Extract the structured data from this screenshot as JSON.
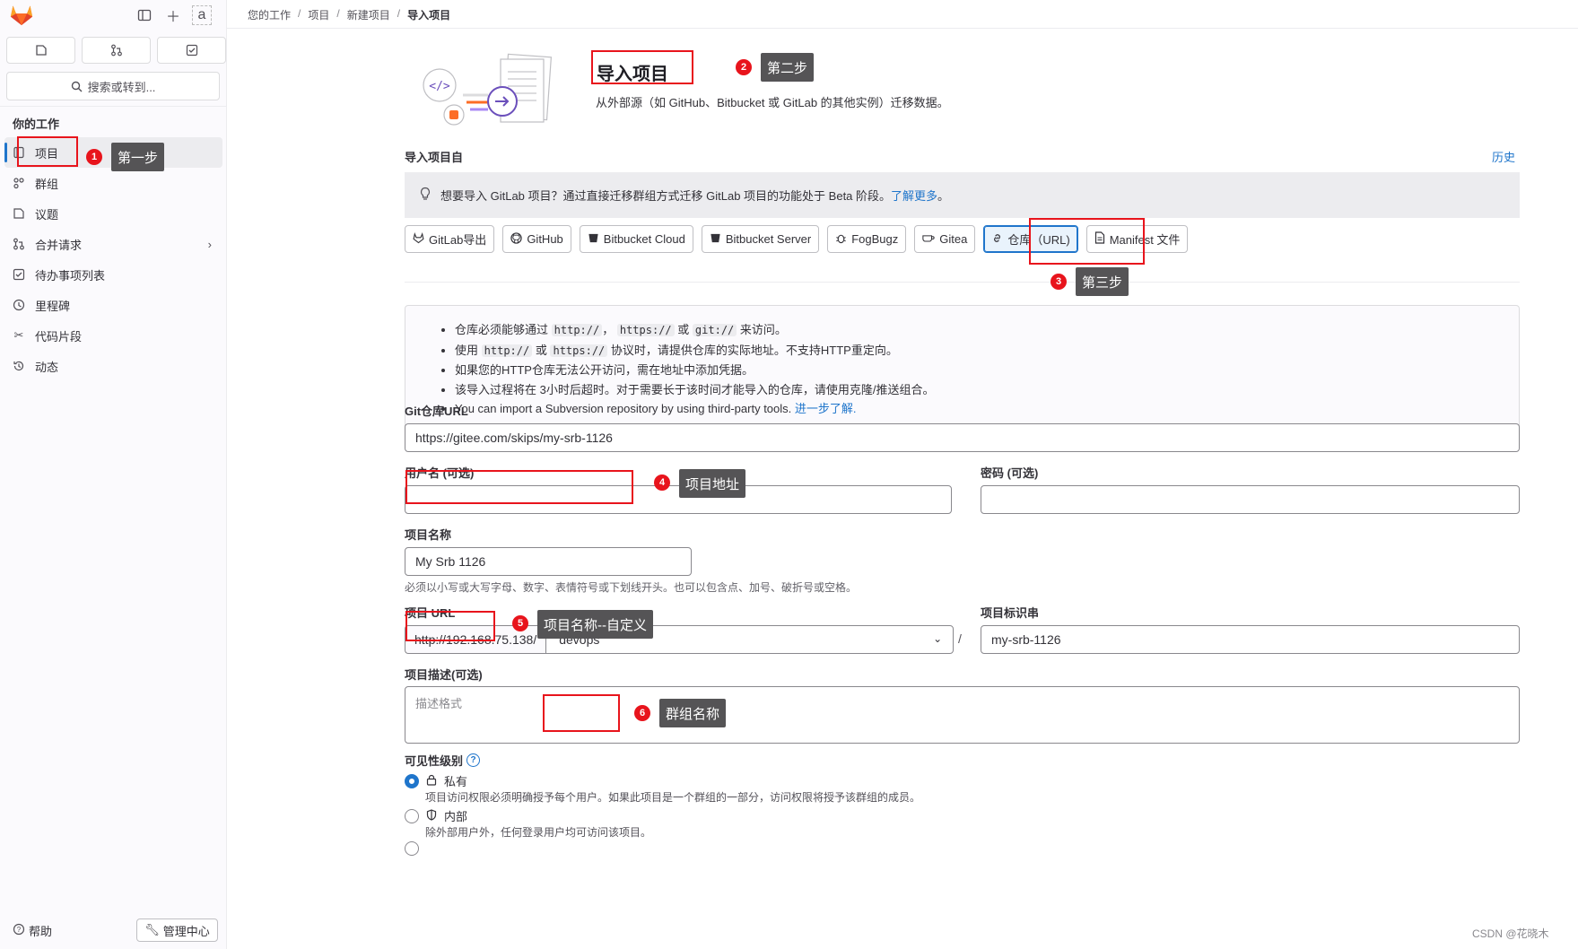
{
  "sidebar": {
    "search_label": "搜索或转到...",
    "section_title": "你的工作",
    "items": [
      {
        "label": "项目"
      },
      {
        "label": "群组"
      },
      {
        "label": "议题"
      },
      {
        "label": "合并请求"
      },
      {
        "label": "待办事项列表"
      },
      {
        "label": "里程碑"
      },
      {
        "label": "代码片段"
      },
      {
        "label": "动态"
      }
    ],
    "help_label": "帮助",
    "admin_label": "管理中心",
    "avatar_alt": "a"
  },
  "breadcrumb": [
    "您的工作",
    "项目",
    "新建项目",
    "导入项目"
  ],
  "page": {
    "title": "导入项目",
    "description": "从外部源（如 GitHub、Bitbucket 或 GitLab 的其他实例）迁移数据。",
    "import_from": "导入项目自",
    "history": "历史",
    "beta_alert": "想要导入 GitLab 项目？通过直接迁移群组方式迁移 GitLab 项目的功能处于 Beta 阶段。",
    "beta_link": "了解更多",
    "beta_end": "。"
  },
  "sources": [
    {
      "label": "GitLab导出",
      "icon": "gitlab-icon"
    },
    {
      "label": "GitHub",
      "icon": "github-icon"
    },
    {
      "label": "Bitbucket Cloud",
      "icon": "bitbucket-icon"
    },
    {
      "label": "Bitbucket Server",
      "icon": "bitbucket-icon"
    },
    {
      "label": "FogBugz",
      "icon": "bug-icon"
    },
    {
      "label": "Gitea",
      "icon": "gitea-icon"
    },
    {
      "label": "仓库（URL)",
      "icon": "link-icon"
    },
    {
      "label": "Manifest 文件",
      "icon": "document-icon"
    }
  ],
  "info": {
    "l1a": "仓库必须能够通过",
    "l1c1": "http://",
    "l1b": "，",
    "l1c2": "https://",
    "l1d": "或",
    "l1c3": "git://",
    "l1e": "来访问。",
    "l2a": "使用",
    "l2c1": "http://",
    "l2b": "或",
    "l2c2": "https://",
    "l2c": "协议时，请提供仓库的实际地址。不支持HTTP重定向。",
    "l3": "如果您的HTTP仓库无法公开访问，需在地址中添加凭据。",
    "l4": "该导入过程将在 3小时后超时。对于需要长于该时间才能导入的仓库，请使用克隆/推送组合。",
    "l5": "You can import a Subversion repository by using third-party tools.",
    "l5_link": "进一步了解."
  },
  "form": {
    "git_url_label": "Git仓库URL",
    "git_url_value": "https://gitee.com/skips/my-srb-1126",
    "username_label": "用户名 (可选)",
    "password_label": "密码 (可选)",
    "project_name_label": "项目名称",
    "project_name_value": "My Srb 1126",
    "project_name_hint": "必须以小写或大写字母、数字、表情符号或下划线开头。也可以包含点、加号、破折号或空格。",
    "project_url_label": "项目 URL",
    "project_url_prefix": "http://192.168.75.138/",
    "namespace_value": "devops",
    "slug_label": "项目标识串",
    "slug_value": "my-srb-1126",
    "description_label": "项目描述(可选)",
    "description_placeholder": "描述格式",
    "visibility_label": "可见性级别",
    "visibility": [
      {
        "label": "私有",
        "desc": "项目访问权限必须明确授予每个用户。如果此项目是一个群组的一部分，访问权限将授予该群组的成员。",
        "selected": true
      },
      {
        "label": "内部",
        "desc": "除外部用户外，任何登录用户均可访问该项目。",
        "selected": false
      }
    ]
  },
  "annotations": [
    {
      "num": "1",
      "text": "第一步"
    },
    {
      "num": "2",
      "text": "第二步"
    },
    {
      "num": "3",
      "text": "第三步"
    },
    {
      "num": "4",
      "text": "项目地址"
    },
    {
      "num": "5",
      "text": "项目名称--自定义"
    },
    {
      "num": "6",
      "text": "群组名称"
    }
  ],
  "watermark": "CSDN @花晓木",
  "colors": {
    "accent": "#1f75cb",
    "annotation_red": "#e8141c",
    "callout_bg": "#555456",
    "gitlab_orange": "#e24329"
  }
}
